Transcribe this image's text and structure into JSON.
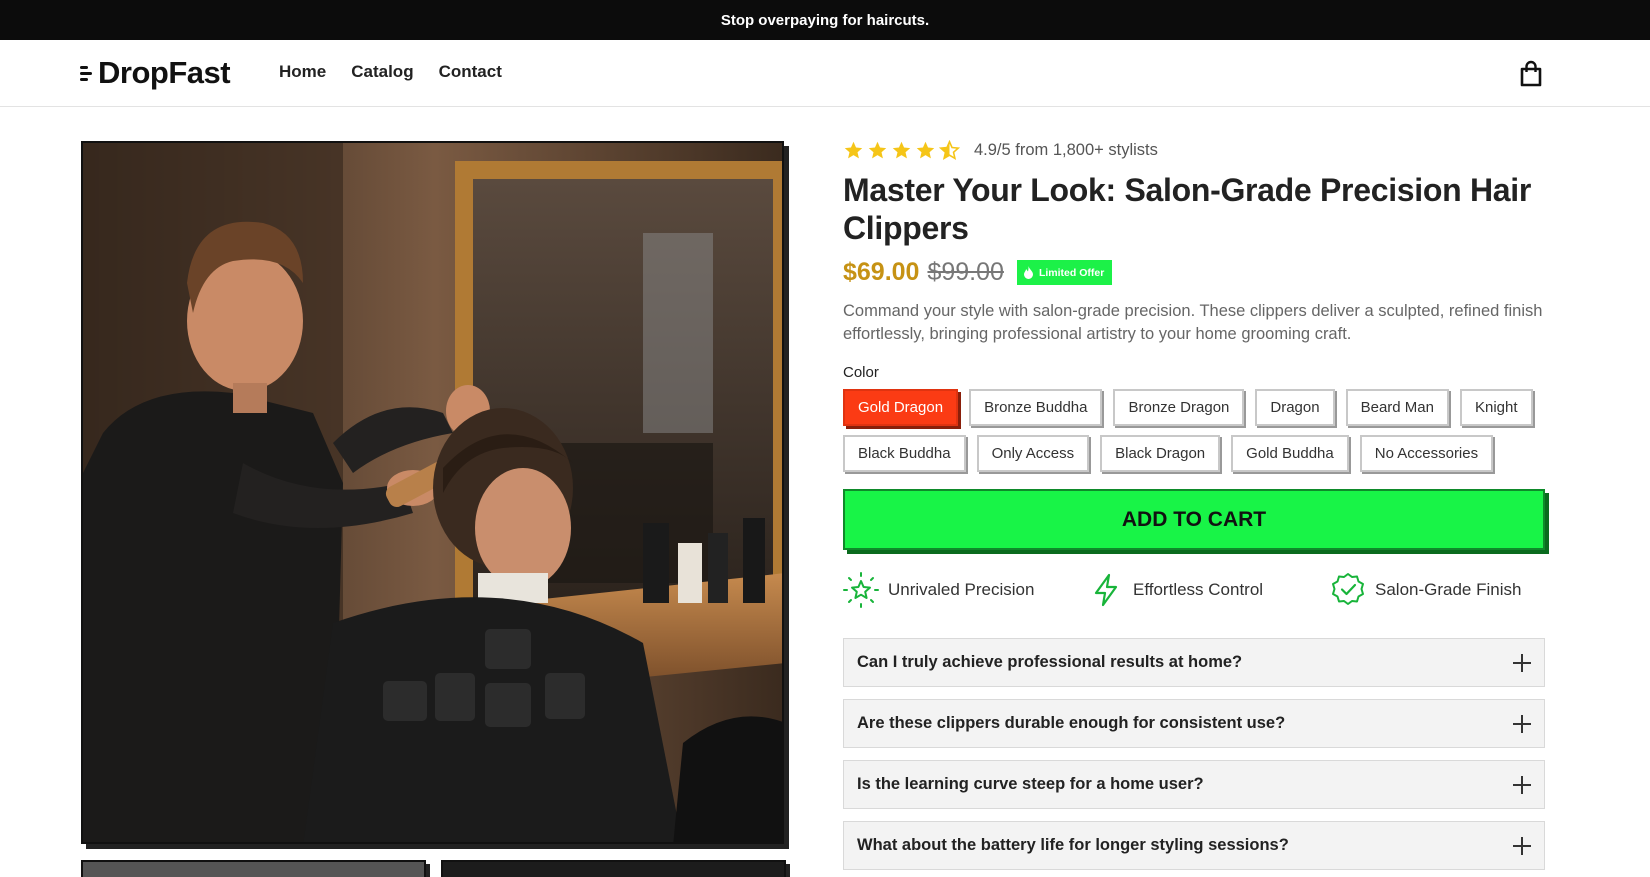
{
  "announcement": "Stop overpaying for haircuts.",
  "brand": {
    "name": "DropFast"
  },
  "nav": [
    "Home",
    "Catalog",
    "Contact"
  ],
  "icons": {
    "cart": "shopping-bag-icon",
    "star": "star-icon",
    "plus": "plus-icon"
  },
  "product": {
    "rating_text": "4.9/5 from 1,800+ stylists",
    "rating_value": 4.5,
    "title": "Master Your Look: Salon-Grade Precision Hair Clippers",
    "price": "$69.00",
    "compare_price": "$99.00",
    "badge": "Limited Offer",
    "description": "Command your style with salon-grade precision. These clippers deliver a sculpted, refined finish effortlessly, bringing professional artistry to your home grooming craft.",
    "color_label": "Color",
    "variants": [
      "Gold Dragon",
      "Bronze Buddha",
      "Bronze Dragon",
      "Dragon",
      "Beard Man",
      "Knight",
      "Black Buddha",
      "Only Access",
      "Black Dragon",
      "Gold Buddha",
      "No Accessories"
    ],
    "selected_variant": "Gold Dragon",
    "add_to_cart": "ADD TO CART",
    "features": [
      "Unrivaled Precision",
      "Effortless Control",
      "Salon-Grade Finish"
    ],
    "faqs": [
      "Can I truly achieve professional results at home?",
      "Are these clippers durable enough for consistent use?",
      "Is the learning curve steep for a home user?",
      "What about the battery life for longer styling sessions?"
    ]
  },
  "colors": {
    "price": "#c69214",
    "accent_green": "#18f447",
    "selected_variant": "#fb3b14",
    "star": "#f5c518"
  }
}
